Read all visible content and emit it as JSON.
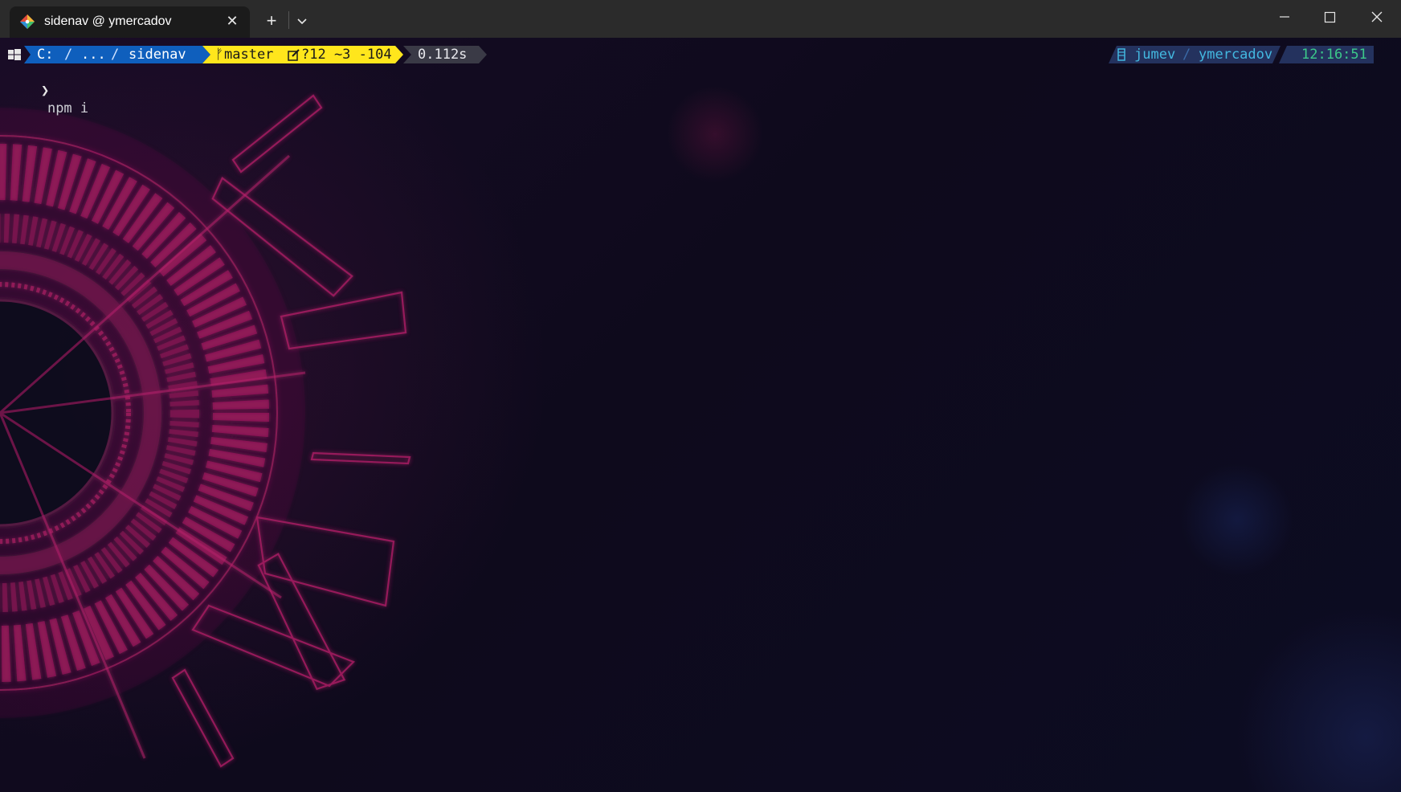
{
  "window": {
    "tab_title": "sidenav @ ymercadov",
    "tab_close": "✕",
    "new_tab": "+",
    "icons": {
      "tab": "git-diamond-icon",
      "dropdown": "chevron-down-icon",
      "minimize": "minimize-icon",
      "maximize": "maximize-icon",
      "close": "close-icon"
    }
  },
  "prompt": {
    "os_icon": "windows-icon",
    "path": [
      "C:",
      "...",
      "sidenav"
    ],
    "path_sep": "/",
    "git": {
      "branch_glyph": "ᚠ",
      "branch": "master",
      "edit_icon": "pencil-square-icon",
      "stats": "?12 ~3 -104"
    },
    "duration": "0.112s",
    "right": {
      "context_icon": "kubernetes-icon",
      "user": "jumev",
      "sep": "/",
      "host": "ymercadov",
      "time": "12:16:51"
    }
  },
  "command": {
    "chevron": "❯",
    "text": "npm i"
  },
  "colors": {
    "path_bg": "#0f5fbd",
    "git_bg": "#ffe61c",
    "duration_bg": "#3a3a46",
    "right_bg": "#24325e",
    "right_text": "#43b8e0",
    "time_text": "#3cc98a",
    "deco": "#b01f67"
  }
}
